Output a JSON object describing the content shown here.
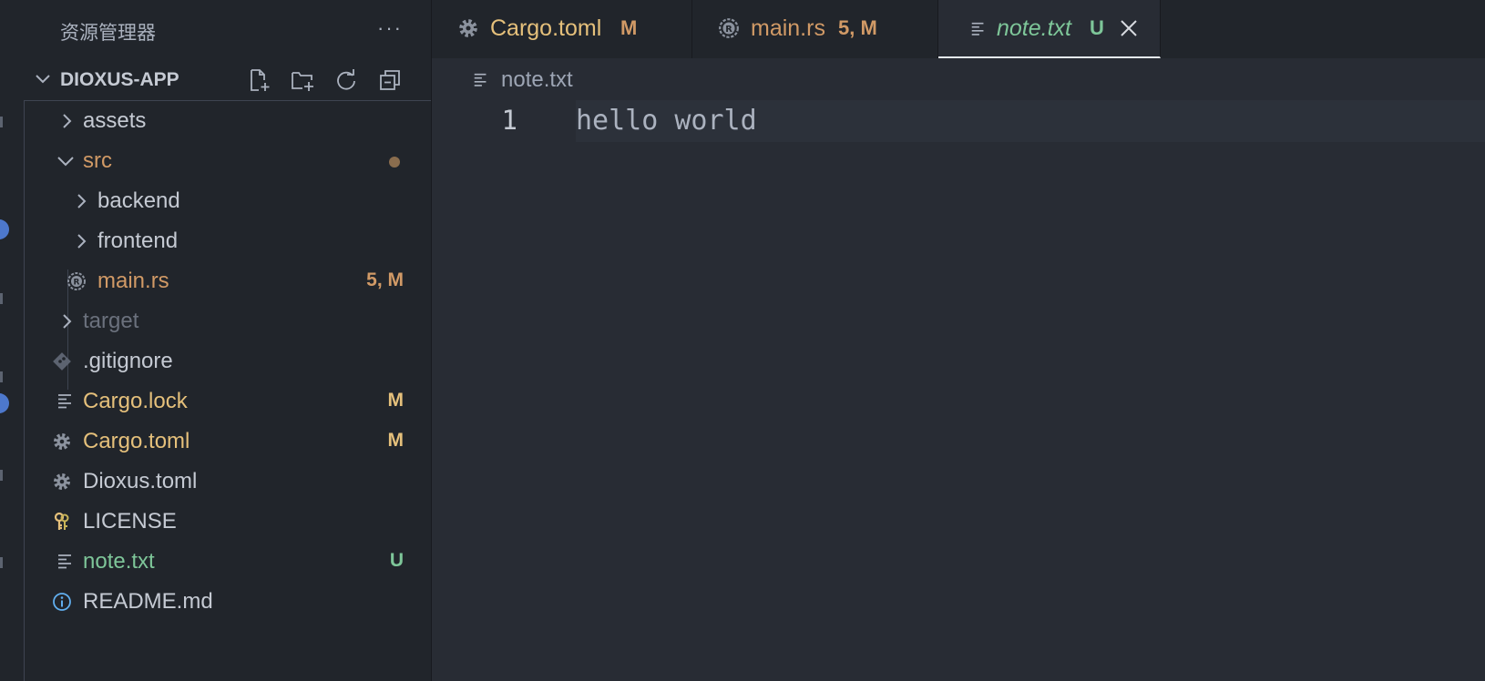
{
  "colors": {
    "modified": "#e5c07b",
    "untracked": "#7ec699",
    "accent_dot": "#4d78cc",
    "rust_file": "#d19a66",
    "ignored": "#6b717d"
  },
  "explorer": {
    "title": "资源管理器",
    "more_icon": "ellipsis-icon",
    "section_title": "DIOXUS-APP",
    "toolbar": [
      "new-file-icon",
      "new-folder-icon",
      "refresh-icon",
      "collapse-all-icon"
    ],
    "items": [
      {
        "label": "assets",
        "type": "folder",
        "expanded": false
      },
      {
        "label": "src",
        "type": "folder",
        "expanded": true,
        "badge": "●"
      },
      {
        "label": "backend",
        "type": "folder",
        "expanded": false
      },
      {
        "label": "frontend",
        "type": "folder",
        "expanded": false
      },
      {
        "label": "main.rs",
        "type": "file",
        "icon": "rust-icon",
        "badge": "5, M"
      },
      {
        "label": "target",
        "type": "folder",
        "expanded": false
      },
      {
        "label": ".gitignore",
        "type": "file",
        "icon": "git-icon"
      },
      {
        "label": "Cargo.lock",
        "type": "file",
        "icon": "text-file-icon",
        "badge": "M"
      },
      {
        "label": "Cargo.toml",
        "type": "file",
        "icon": "gear-icon",
        "badge": "M"
      },
      {
        "label": "Dioxus.toml",
        "type": "file",
        "icon": "gear-icon"
      },
      {
        "label": "LICENSE",
        "type": "file",
        "icon": "license-key-icon"
      },
      {
        "label": "note.txt",
        "type": "file",
        "icon": "text-file-icon",
        "badge": "U"
      },
      {
        "label": "README.md",
        "type": "file",
        "icon": "info-icon"
      }
    ]
  },
  "tabs": [
    {
      "label": "Cargo.toml",
      "badge": "M",
      "icon": "gear-icon",
      "active": false
    },
    {
      "label": "main.rs",
      "badge": "5, M",
      "icon": "rust-icon",
      "active": false
    },
    {
      "label": "note.txt",
      "badge": "U",
      "icon": "text-file-icon",
      "active": true,
      "close_icon": "close-icon"
    }
  ],
  "breadcrumb": {
    "file": "note.txt",
    "icon": "text-file-icon"
  },
  "editor": {
    "lines": [
      {
        "number": "1",
        "text": "hello world"
      }
    ]
  }
}
